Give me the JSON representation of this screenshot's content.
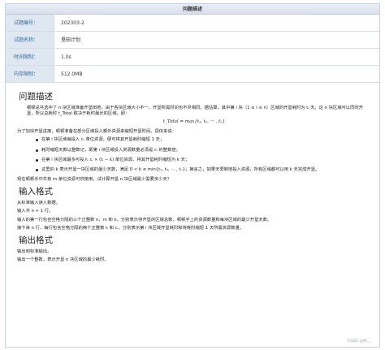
{
  "header": {
    "title": "问题描述"
  },
  "info": [
    {
      "label": "试题编号：",
      "value": "202303-2"
    },
    {
      "label": "试题名称：",
      "value": "垦田计划"
    },
    {
      "label": "时间限制：",
      "value": "1.0s"
    },
    {
      "label": "内存限制：",
      "value": "512.0MB"
    }
  ],
  "problem": {
    "heading": "问题描述",
    "intro": "顿顿总共选中了 n 块区域准备开垦田地，由于各块区域大小不一，开垦所需时间也不尽相同。据估算，其中第 i 块（1 ≤ i ≤ n）区域的开垦耗时为 tᵢ 天。这 n 块区域可以同时开垦，所以总耗时 t_Total 取决于耗时最长的区域，即：",
    "formula": "t_Total = max{t₁, t₂, ··· , tₙ}",
    "para2": "为了加快开垦进度，顿顿准备在部分区域投入额外资源来缩短开垦时间。具体来说：",
    "bullets": [
      "在第 i 块区域每投入 cᵢ 单位资源，便可将其开垦耗时缩短 1 天；",
      "耗时缩短天数以整数记，即第 i 块区域投入资源数量必须是 cᵢ 的整数倍；",
      "在第 i 块区域最多可投入 cᵢ × (tᵢ − k) 单位资源，将其开垦耗时缩短为 k 天；",
      "这里的 k 表示开垦一块区域的最少天数，满足 0 < k ≤ min{t₁, t₂, ··· , tₙ}；换言之，如果无限制地投入资源，所有区域都可以用 k 天完成开垦。"
    ],
    "para3": "现在顿顿手中共有 m 单位资源可供使用，试计算开垦 n 块区域最少需要多少天？"
  },
  "input": {
    "heading": "输入格式",
    "lines": [
      "从标准输入读入数据。",
      "输入共 n + 1 行。",
      "输入的第一行包含空格分隔的三个正整数 n、m 和 k，分别表示待开垦的区域总数、顿顿手上的资源数量和每块区域的最少开垦天数。",
      "接下来 n 行，每行包含空格分隔的两个正整数 tᵢ 和 cᵢ，分别表示第 i 块区域开垦耗时和将耗时缩短 1 天所需资源数量。"
    ]
  },
  "output": {
    "heading": "输出格式",
    "lines": [
      "输出到标准输出。",
      "输出一个整数，表示开垦 n 块区域的最少耗时。"
    ]
  },
  "watermark": "CSDN @Mr_..."
}
